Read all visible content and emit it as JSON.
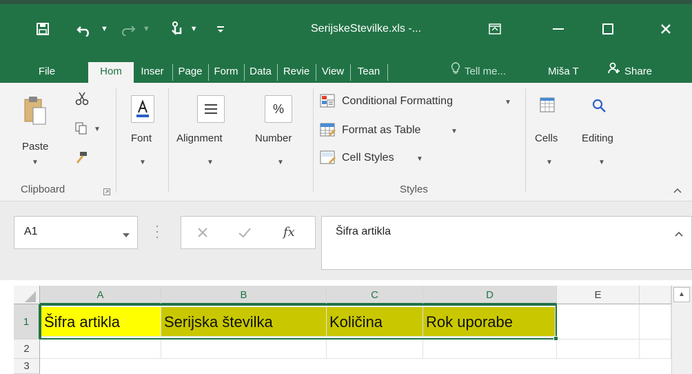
{
  "window": {
    "title": "SerijskeStevilke.xls -...",
    "qat": {
      "save_icon": "save-icon",
      "undo_icon": "undo-icon",
      "redo_icon": "redo-icon",
      "touch_icon": "touch-mode-icon",
      "customize_icon": "customize-qat-icon"
    }
  },
  "tabs": [
    "File",
    "Hom",
    "Inser",
    "Page",
    "Form",
    "Data",
    "Revie",
    "View",
    "Tean"
  ],
  "tell_me": "Tell me...",
  "user": "Miša T",
  "share": "Share",
  "ribbon": {
    "clipboard": {
      "paste": "Paste",
      "group": "Clipboard"
    },
    "font": "Font",
    "alignment": "Alignment",
    "number": "Number",
    "styles": {
      "conditional": "Conditional Formatting",
      "format_table": "Format as Table",
      "cell_styles": "Cell Styles",
      "group": "Styles"
    },
    "cells": "Cells",
    "editing": "Editing"
  },
  "formula_bar": {
    "name_box": "A1",
    "fx": "fx",
    "content": "Šifra artikla"
  },
  "grid": {
    "columns": [
      "A",
      "B",
      "C",
      "D",
      "E"
    ],
    "rows": [
      "1",
      "2",
      "3"
    ],
    "row1": [
      "Šifra artikla",
      "Serijska številka",
      "Količina",
      "Rok uporabe",
      ""
    ],
    "highlight_color": "#c9c800",
    "active_cell_color": "#ffff00"
  },
  "accent_color": "#217346"
}
